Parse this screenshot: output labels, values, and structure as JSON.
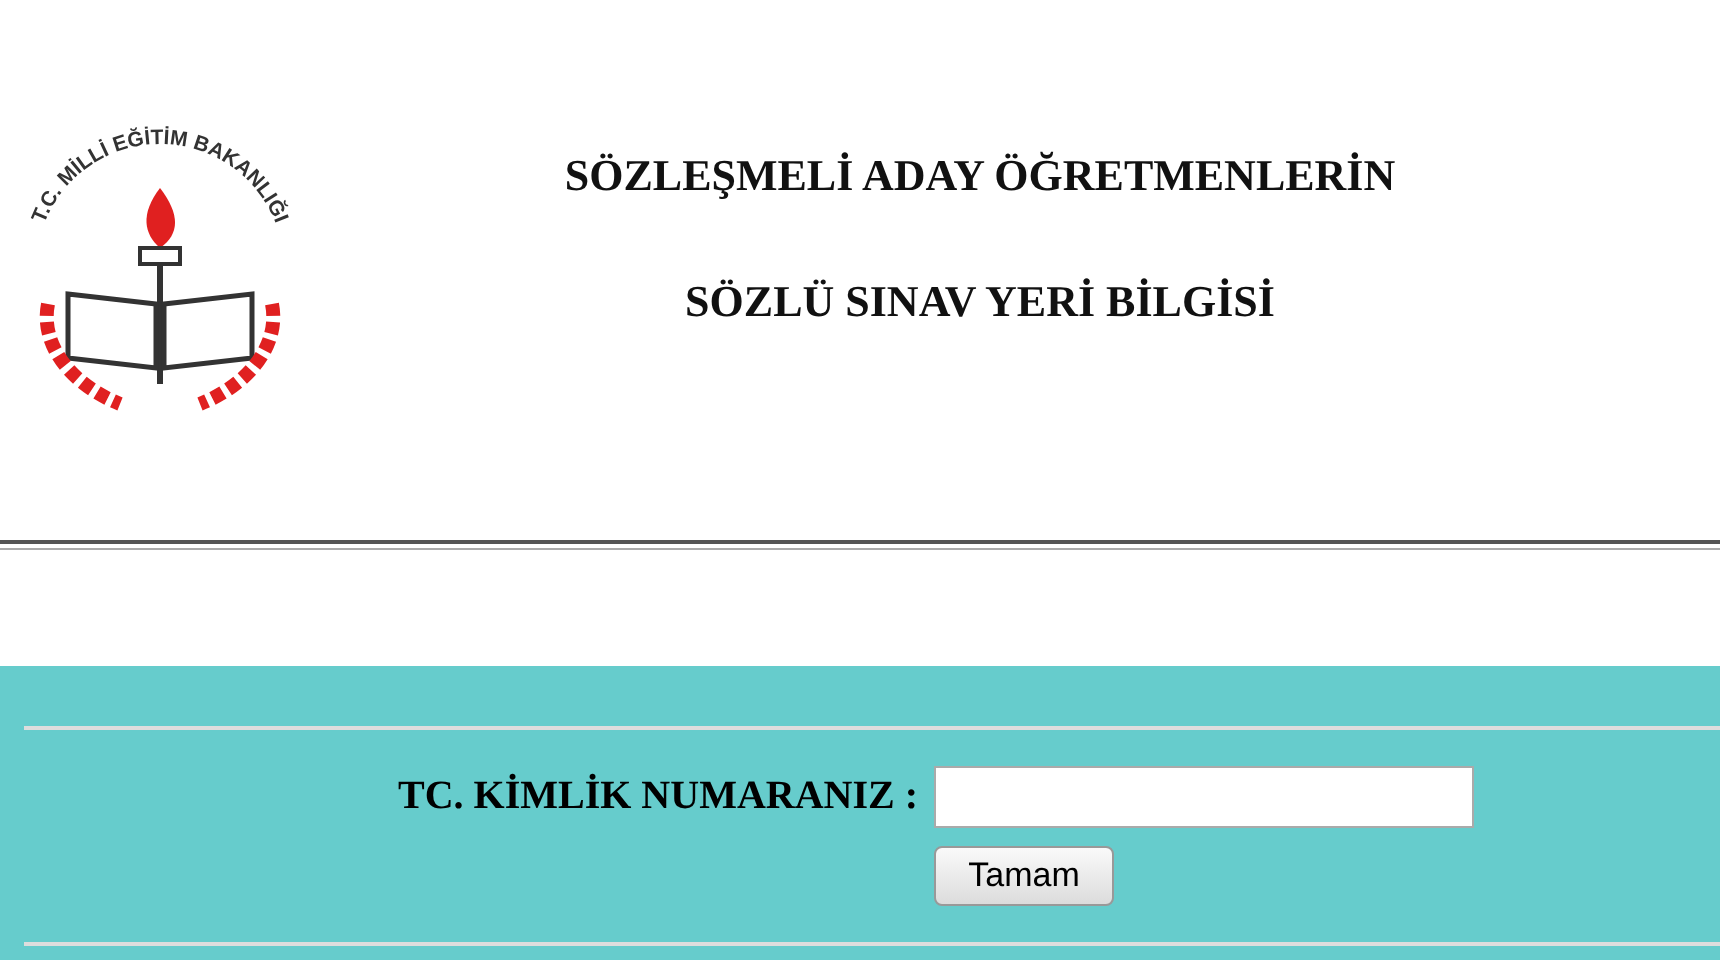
{
  "logo": {
    "text": "T.C. MİLLİ EĞİTİM BAKANLIĞI"
  },
  "header": {
    "titles": [
      "SÖZLEŞMELİ ADAY ÖĞRETMENLERİN",
      "SÖZLÜ SINAV YERİ BİLGİSİ"
    ]
  },
  "form": {
    "label": "TC. KİMLİK NUMARANIZ :",
    "button": "Tamam"
  }
}
